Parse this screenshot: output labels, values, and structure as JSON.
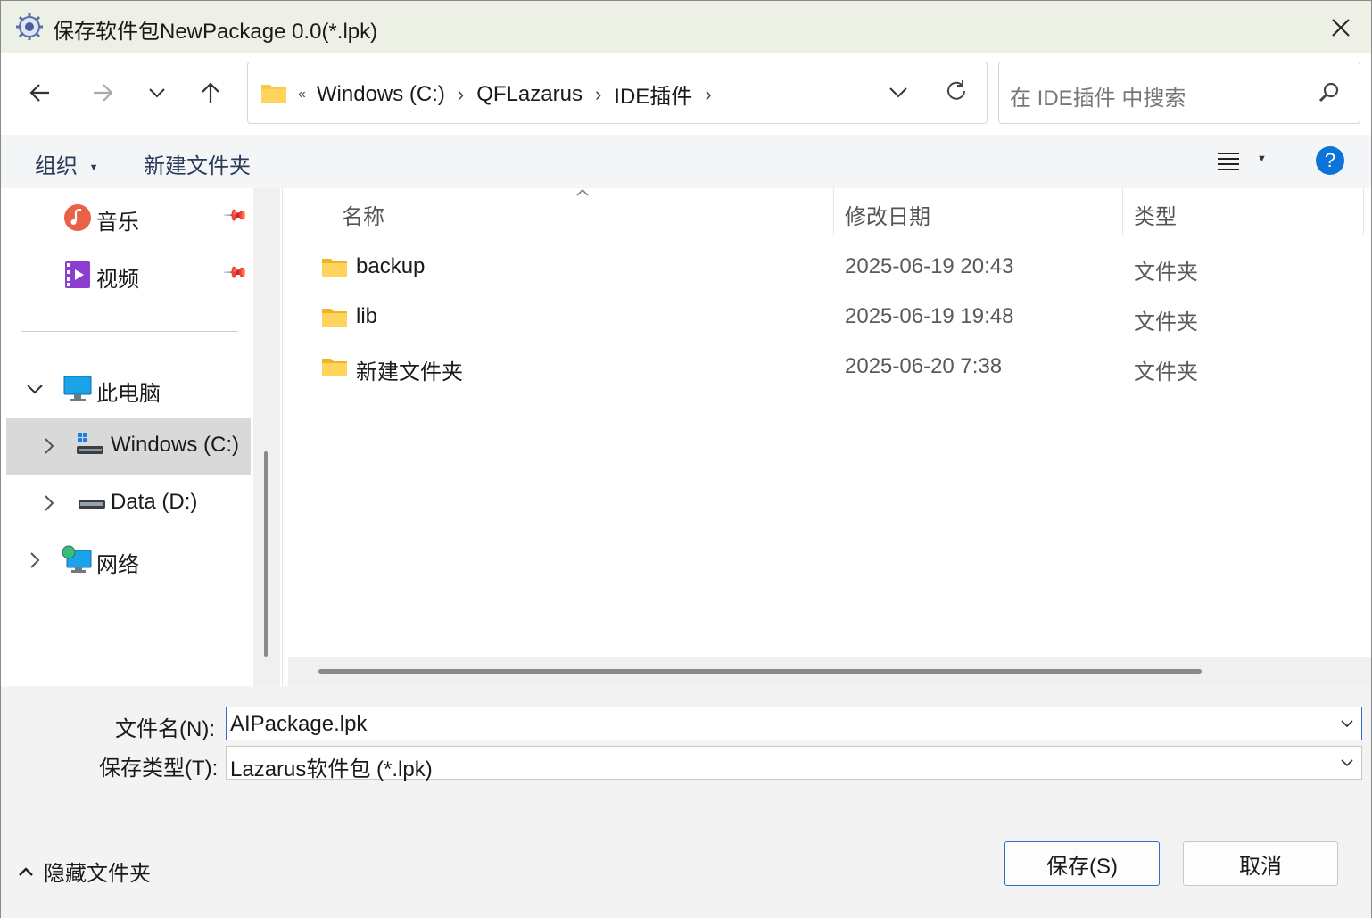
{
  "window": {
    "title": "保存软件包NewPackage 0.0(*.lpk)"
  },
  "nav": {
    "path": [
      "Windows (C:)",
      "QFLazarus",
      "IDE插件"
    ],
    "overflow_marker": "«",
    "search_placeholder": "在 IDE插件 中搜索"
  },
  "toolbar": {
    "organize_label": "组织",
    "new_folder_label": "新建文件夹",
    "help_label": "?"
  },
  "sidebar": {
    "items": [
      {
        "label": "音乐",
        "icon": "music-icon",
        "pinned": true
      },
      {
        "label": "视频",
        "icon": "video-icon",
        "pinned": true
      },
      {
        "label": "此电脑",
        "icon": "computer-icon",
        "expanded": true
      },
      {
        "label": "Windows (C:)",
        "icon": "windows-drive-icon",
        "selected": true
      },
      {
        "label": "Data (D:)",
        "icon": "drive-icon"
      },
      {
        "label": "网络",
        "icon": "network-icon"
      }
    ]
  },
  "filelist": {
    "columns": [
      "名称",
      "修改日期",
      "类型"
    ],
    "rows": [
      {
        "name": "backup",
        "date": "2025-06-19 20:43",
        "type": "文件夹"
      },
      {
        "name": "lib",
        "date": "2025-06-19 19:48",
        "type": "文件夹"
      },
      {
        "name": "新建文件夹",
        "date": "2025-06-20 7:38",
        "type": "文件夹"
      }
    ]
  },
  "form": {
    "filename_label": "文件名(N):",
    "filename_value": "AIPackage.lpk",
    "filetype_label": "保存类型(T):",
    "filetype_value": "Lazarus软件包 (*.lpk)"
  },
  "footer": {
    "hide_folders_label": "隐藏文件夹",
    "save_label": "保存(S)",
    "cancel_label": "取消"
  },
  "colors": {
    "accent": "#0a74d8",
    "titlebar_bg": "#edf0e4",
    "folder": "#f7c948",
    "selection": "#d9d9d9"
  }
}
